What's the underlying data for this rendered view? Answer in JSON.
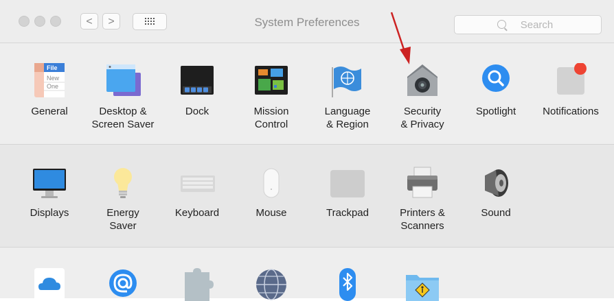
{
  "window": {
    "title": "System Preferences",
    "back_label": "<",
    "forward_label": ">",
    "search": {
      "placeholder": "Search",
      "value": ""
    }
  },
  "row1": [
    {
      "name": "general",
      "label": "General"
    },
    {
      "name": "desktop-screen-saver",
      "label": "Desktop &\nScreen Saver"
    },
    {
      "name": "dock",
      "label": "Dock"
    },
    {
      "name": "mission-control",
      "label": "Mission\nControl"
    },
    {
      "name": "language-region",
      "label": "Language\n& Region"
    },
    {
      "name": "security-privacy",
      "label": "Security\n& Privacy"
    },
    {
      "name": "spotlight",
      "label": "Spotlight"
    },
    {
      "name": "notifications",
      "label": "Notifications"
    }
  ],
  "row2": [
    {
      "name": "displays",
      "label": "Displays"
    },
    {
      "name": "energy-saver",
      "label": "Energy\nSaver"
    },
    {
      "name": "keyboard",
      "label": "Keyboard"
    },
    {
      "name": "mouse",
      "label": "Mouse"
    },
    {
      "name": "trackpad",
      "label": "Trackpad"
    },
    {
      "name": "printers-scanners",
      "label": "Printers &\nScanners"
    },
    {
      "name": "sound",
      "label": "Sound"
    }
  ],
  "general_icon_text": [
    "File",
    "New",
    "One"
  ],
  "colors": {
    "annotation_arrow": "#cc2222",
    "notification_dot": "#ee4433"
  }
}
